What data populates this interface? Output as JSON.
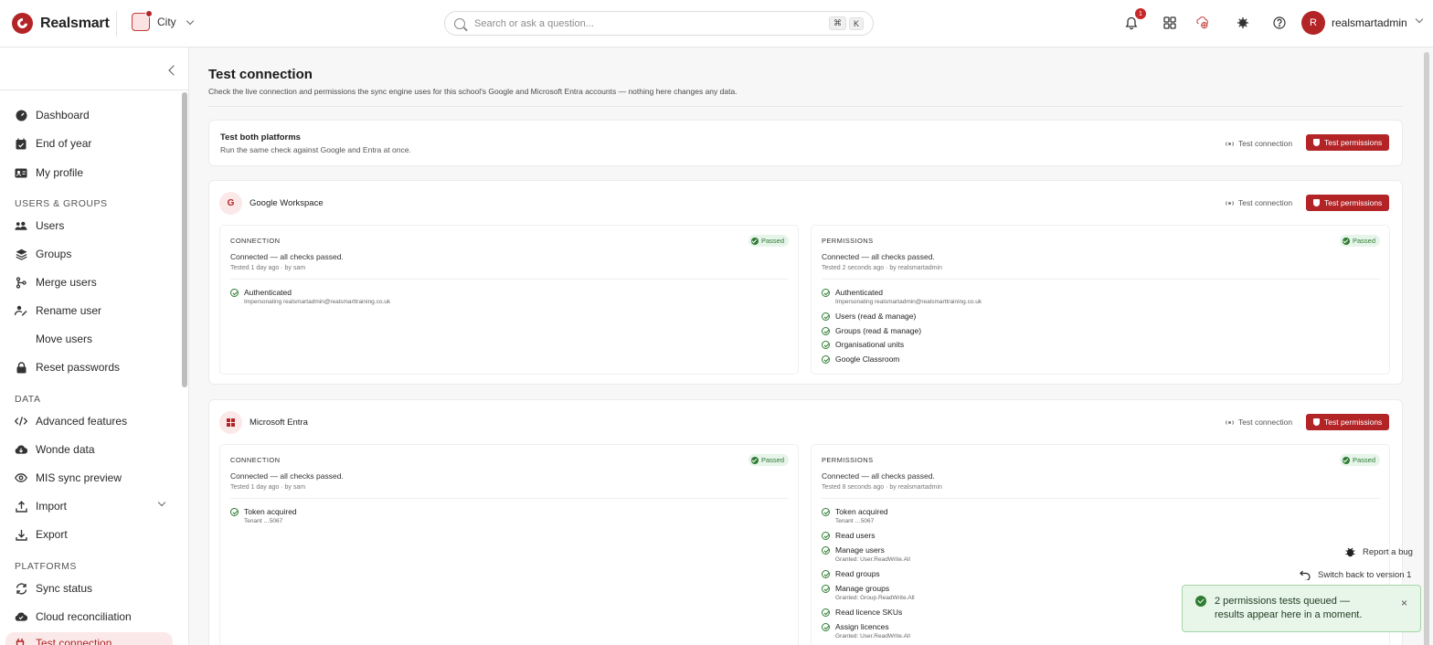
{
  "app": {
    "name": "Realsmart"
  },
  "school": {
    "name": "City"
  },
  "search": {
    "placeholder": "Search or ask a question...",
    "shortcut_mod": "⌘",
    "shortcut_key": "K"
  },
  "notifications": {
    "count": "1"
  },
  "user": {
    "initial": "R",
    "name": "realsmartadmin"
  },
  "sidebar": {
    "items": [
      {
        "label": "Dashboard"
      },
      {
        "label": "End of year"
      },
      {
        "label": "My profile"
      }
    ],
    "users_groups_heading": "USERS & GROUPS",
    "users_groups": [
      {
        "label": "Users"
      },
      {
        "label": "Groups"
      },
      {
        "label": "Merge users"
      },
      {
        "label": "Rename user"
      },
      {
        "label": "Move users"
      },
      {
        "label": "Reset passwords"
      }
    ],
    "data_heading": "DATA",
    "data": [
      {
        "label": "Advanced features"
      },
      {
        "label": "Wonde data"
      },
      {
        "label": "MIS sync preview"
      },
      {
        "label": "Import"
      },
      {
        "label": "Export"
      }
    ],
    "platforms_heading": "PLATFORMS",
    "platforms": [
      {
        "label": "Sync status"
      },
      {
        "label": "Cloud reconciliation"
      },
      {
        "label": "Test connection"
      }
    ]
  },
  "page": {
    "title": "Test connection",
    "subtitle": "Check the live connection and permissions the sync engine uses for this school's Google and Microsoft Entra accounts — nothing here changes any data."
  },
  "both": {
    "title": "Test both platforms",
    "subtitle": "Run the same check against Google and Entra at once.",
    "test_connection": "Test connection",
    "test_permissions": "Test permissions"
  },
  "google": {
    "title": "Google Workspace",
    "icon_letter": "G",
    "test_connection": "Test connection",
    "test_permissions": "Test permissions",
    "connection": {
      "label": "CONNECTION",
      "status_badge": "Passed",
      "status": "Connected — all checks passed.",
      "meta": "Tested 1 day ago · by sam",
      "checks": [
        {
          "title": "Authenticated",
          "detail": "Impersonating realsmartadmin@realsmarttraining.co.uk"
        }
      ]
    },
    "permissions": {
      "label": "PERMISSIONS",
      "status_badge": "Passed",
      "status": "Connected — all checks passed.",
      "meta": "Tested 2 seconds ago · by realsmartadmin",
      "checks": [
        {
          "title": "Authenticated",
          "detail": "Impersonating realsmartadmin@realsmarttraining.co.uk"
        },
        {
          "title": "Users (read & manage)"
        },
        {
          "title": "Groups (read & manage)"
        },
        {
          "title": "Organisational units"
        },
        {
          "title": "Google Classroom"
        }
      ]
    }
  },
  "entra": {
    "title": "Microsoft Entra",
    "test_connection": "Test connection",
    "test_permissions": "Test permissions",
    "connection": {
      "label": "CONNECTION",
      "status_badge": "Passed",
      "status": "Connected — all checks passed.",
      "meta": "Tested 1 day ago · by sam",
      "checks": [
        {
          "title": "Token acquired",
          "detail": "Tenant …5067"
        }
      ]
    },
    "permissions": {
      "label": "PERMISSIONS",
      "status_badge": "Passed",
      "status": "Connected — all checks passed.",
      "meta": "Tested 8 seconds ago · by realsmartadmin",
      "checks": [
        {
          "title": "Token acquired",
          "detail": "Tenant …5067"
        },
        {
          "title": "Read users"
        },
        {
          "title": "Manage users",
          "detail": "Granted: User.ReadWrite.All"
        },
        {
          "title": "Read groups"
        },
        {
          "title": "Manage groups",
          "detail": "Granted: Group.ReadWrite.All"
        },
        {
          "title": "Read licence SKUs"
        },
        {
          "title": "Assign licences",
          "detail": "Granted: User.ReadWrite.All"
        }
      ]
    }
  },
  "floating": {
    "report_bug": "Report a bug",
    "switch_version": "Switch back to version 1"
  },
  "toast": {
    "message": "2 permissions tests queued — results appear here in a moment.",
    "close": "×"
  },
  "colors": {
    "brand": "#b32427",
    "success": "#2e7d32"
  }
}
